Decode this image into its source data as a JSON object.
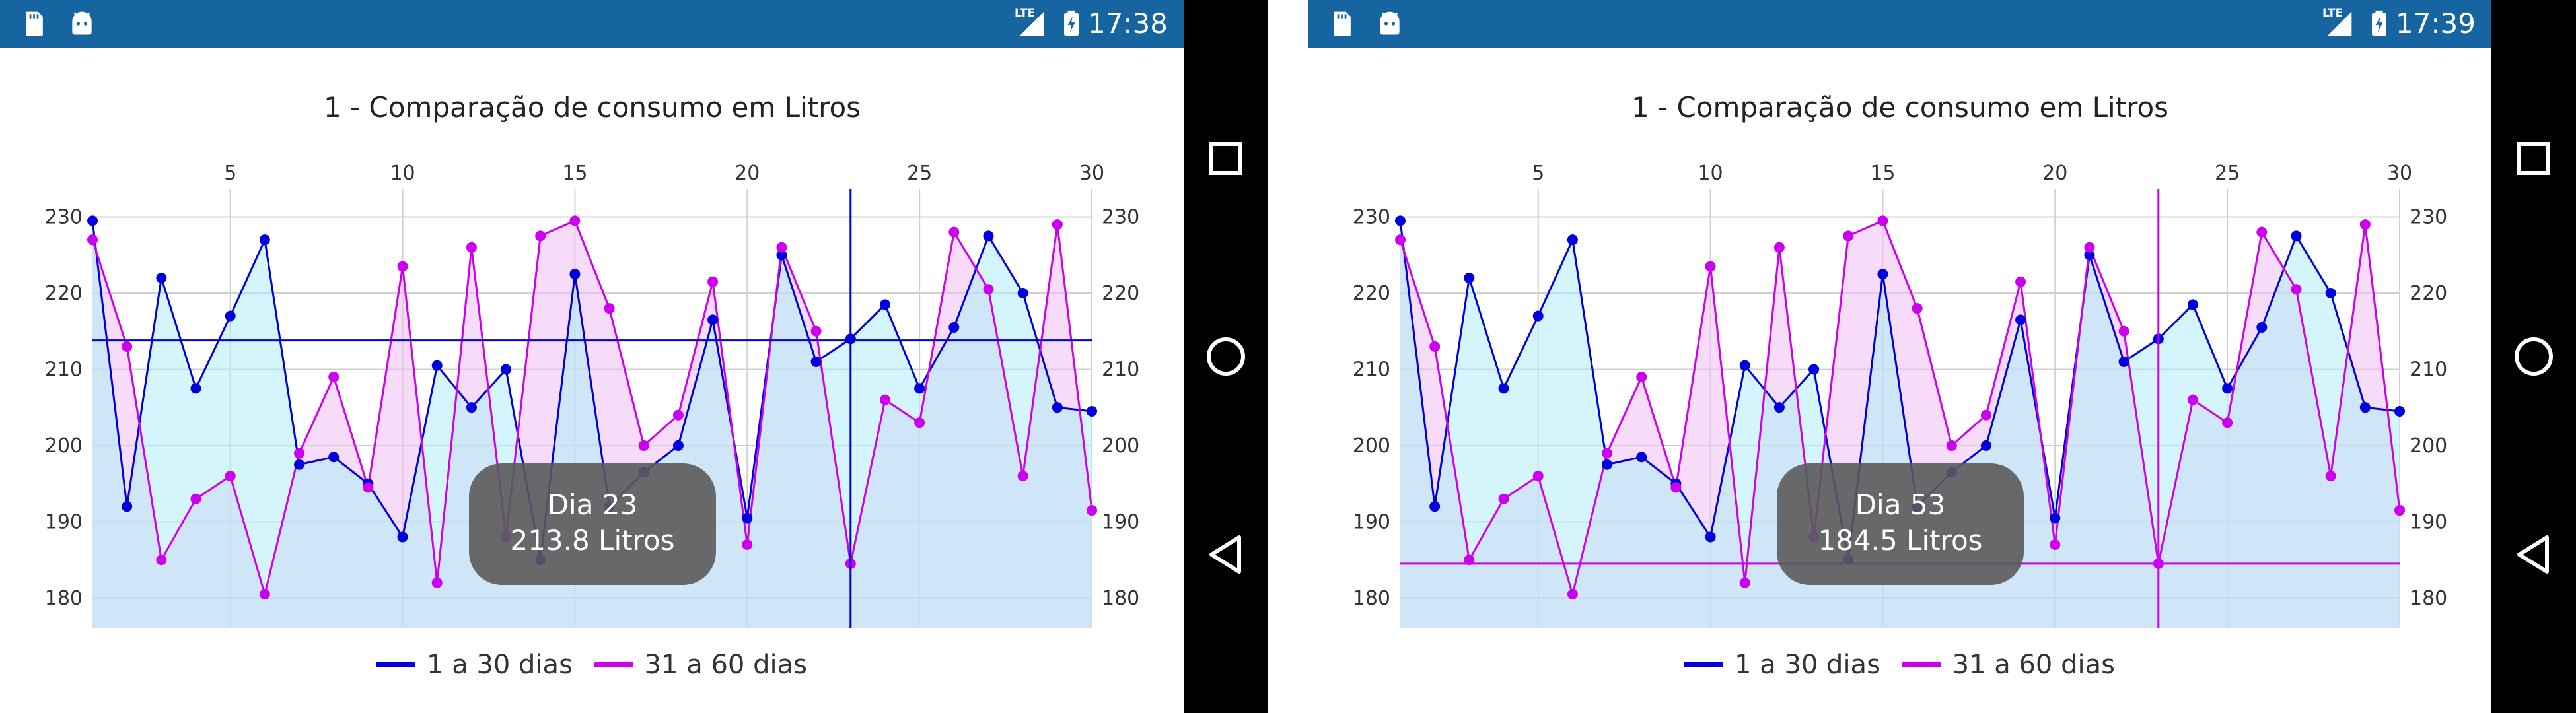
{
  "screens": [
    {
      "status_time": "17:38",
      "status_network": "LTE",
      "chart_data": {
        "type": "line",
        "title": "1 - Comparação de consumo em Litros",
        "x": [
          1,
          2,
          3,
          4,
          5,
          6,
          7,
          8,
          9,
          10,
          11,
          12,
          13,
          14,
          15,
          16,
          17,
          18,
          19,
          20,
          21,
          22,
          23,
          24,
          25,
          26,
          27,
          28,
          29,
          30
        ],
        "x_ticks": [
          5,
          10,
          15,
          20,
          25,
          30
        ],
        "y_ticks": [
          180,
          190,
          200,
          210,
          220,
          230
        ],
        "ylim": [
          176,
          231
        ],
        "xlim": [
          1,
          30
        ],
        "series": [
          {
            "name": "1 a 30 dias",
            "color": "#0000dd",
            "fill": "#aeedf7",
            "values": [
              229.5,
              192,
              222,
              207.5,
              217,
              227,
              197.5,
              198.5,
              195,
              188,
              210.5,
              205,
              210,
              185,
              222.5,
              192,
              196.5,
              200,
              216.5,
              190.5,
              225,
              211,
              214,
              218.5,
              207.5,
              215.5,
              227.5,
              220,
              205,
              204.5
            ]
          },
          {
            "name": "31 a 60 dias",
            "color": "#cc00ee",
            "fill": "#eec0f2",
            "values": [
              227,
              213,
              185,
              193,
              196,
              180.5,
              199,
              209,
              194.5,
              223.5,
              182,
              226,
              188,
              227.5,
              229.5,
              218,
              200,
              204,
              221.5,
              187,
              226,
              215,
              184.5,
              206,
              203,
              228,
              220.5,
              196,
              229,
              191.5
            ]
          }
        ],
        "legend": "bottom-center",
        "grid": true,
        "crosshair": {
          "x": 23,
          "y": 213.8,
          "series": "1 a 30 dias",
          "color": "#0000dd"
        },
        "tooltip": {
          "line1": "Dia 23",
          "line2": "213.8 Litros"
        }
      }
    },
    {
      "status_time": "17:39",
      "status_network": "LTE",
      "chart_data": {
        "type": "line",
        "title": "1 - Comparação de consumo em Litros",
        "x": [
          1,
          2,
          3,
          4,
          5,
          6,
          7,
          8,
          9,
          10,
          11,
          12,
          13,
          14,
          15,
          16,
          17,
          18,
          19,
          20,
          21,
          22,
          23,
          24,
          25,
          26,
          27,
          28,
          29,
          30
        ],
        "x_ticks": [
          5,
          10,
          15,
          20,
          25,
          30
        ],
        "y_ticks": [
          180,
          190,
          200,
          210,
          220,
          230
        ],
        "ylim": [
          176,
          231
        ],
        "xlim": [
          1,
          30
        ],
        "series": [
          {
            "name": "1 a 30 dias",
            "color": "#0000dd",
            "fill": "#aeedf7",
            "values": [
              229.5,
              192,
              222,
              207.5,
              217,
              227,
              197.5,
              198.5,
              195,
              188,
              210.5,
              205,
              210,
              185,
              222.5,
              192,
              196.5,
              200,
              216.5,
              190.5,
              225,
              211,
              214,
              218.5,
              207.5,
              215.5,
              227.5,
              220,
              205,
              204.5
            ]
          },
          {
            "name": "31 a 60 dias",
            "color": "#cc00ee",
            "fill": "#eec0f2",
            "values": [
              227,
              213,
              185,
              193,
              196,
              180.5,
              199,
              209,
              194.5,
              223.5,
              182,
              226,
              188,
              227.5,
              229.5,
              218,
              200,
              204,
              221.5,
              187,
              226,
              215,
              184.5,
              206,
              203,
              228,
              220.5,
              196,
              229,
              191.5
            ]
          }
        ],
        "legend": "bottom-center",
        "grid": true,
        "crosshair": {
          "x": 23,
          "y": 184.5,
          "series": "31 a 60 dias",
          "color": "#cc00ee"
        },
        "tooltip": {
          "line1": "Dia 53",
          "line2": "184.5 Litros"
        }
      }
    }
  ],
  "nav": {
    "icons": [
      "recents-square-icon",
      "home-circle-icon",
      "back-triangle-icon"
    ]
  },
  "status_icons": [
    "sd-card-icon",
    "android-icon",
    "signal-icon",
    "battery-charging-icon"
  ]
}
